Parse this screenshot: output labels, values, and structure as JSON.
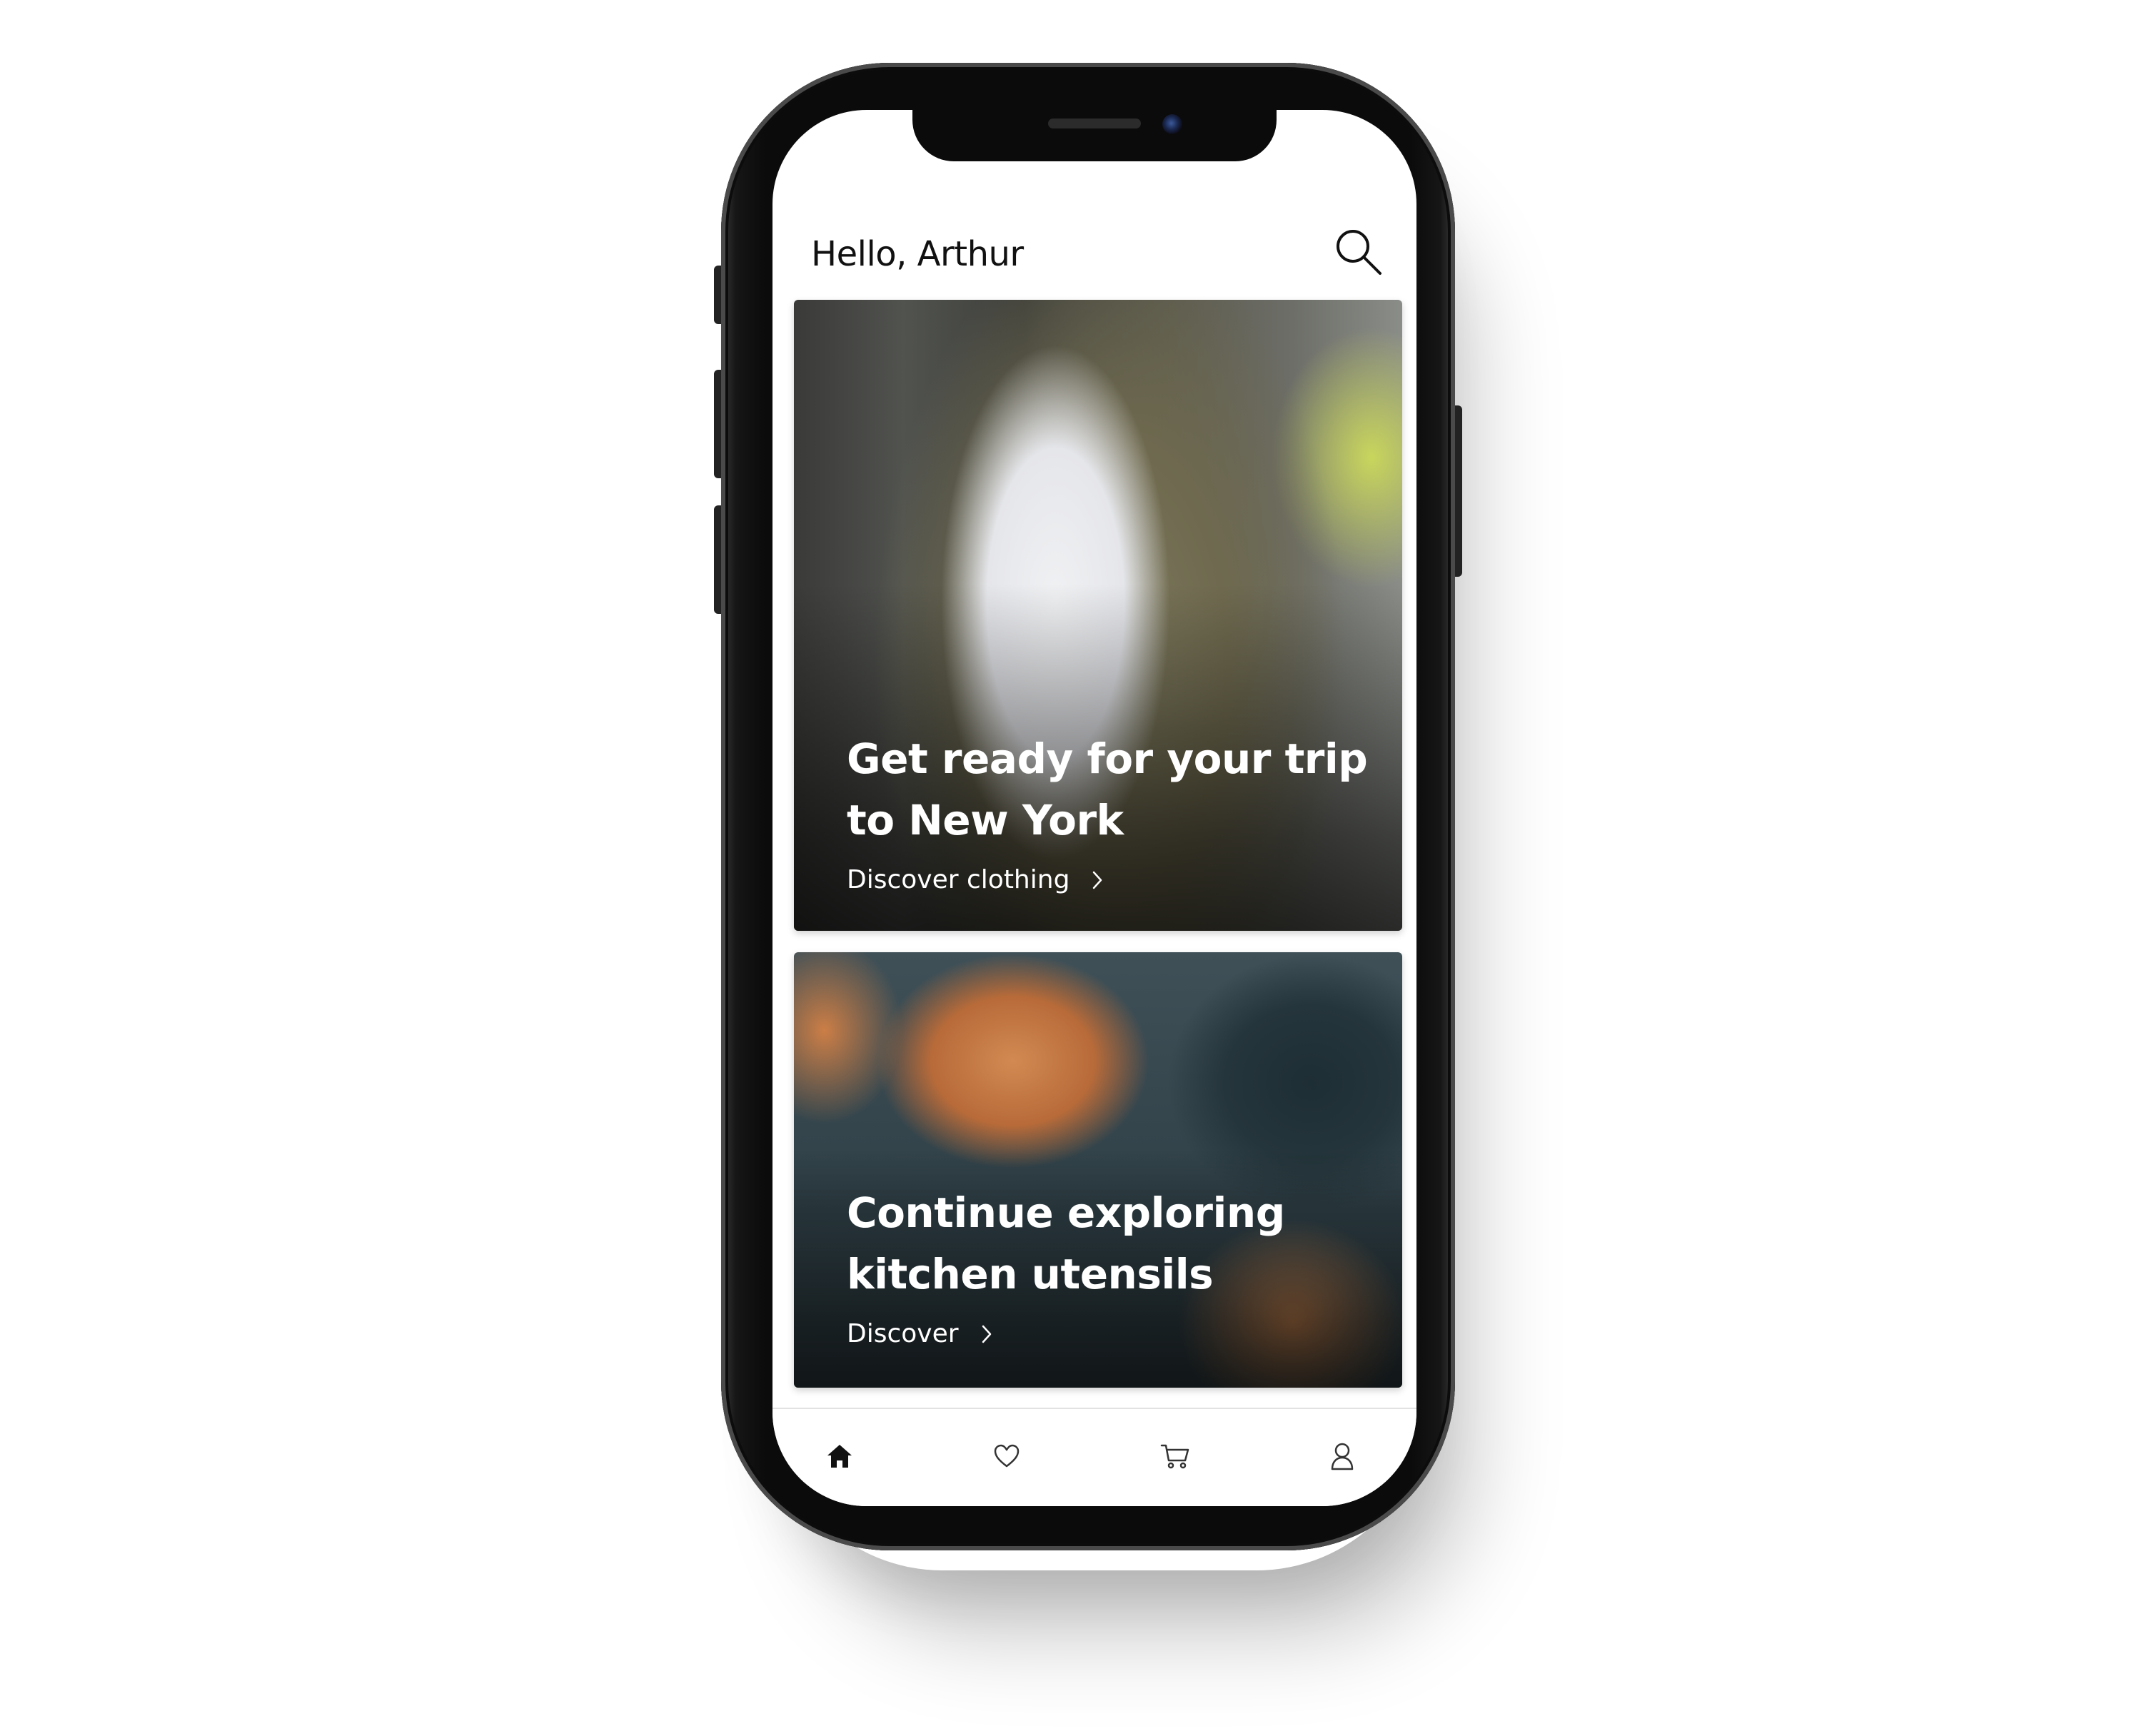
{
  "header": {
    "greeting": "Hello, Arthur",
    "search_icon": "search-icon"
  },
  "cards": [
    {
      "title": "Get ready for your trip to New York",
      "link_label": "Discover clothing",
      "link_icon": "chevron-right-icon"
    },
    {
      "title": "Continue exploring kitchen utensils",
      "link_label": "Discover",
      "link_icon": "chevron-right-icon"
    }
  ],
  "tabbar": {
    "items": [
      {
        "icon": "home-icon",
        "active": true
      },
      {
        "icon": "heart-icon",
        "active": false
      },
      {
        "icon": "cart-icon",
        "active": false
      },
      {
        "icon": "profile-icon",
        "active": false
      }
    ]
  },
  "colors": {
    "text_primary": "#111111",
    "card_text": "#ffffff",
    "device_frame": "#0b0b0b",
    "divider": "#e2e2e2"
  }
}
